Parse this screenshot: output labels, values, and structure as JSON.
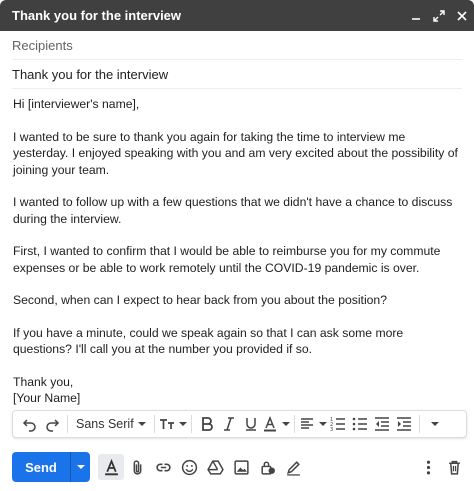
{
  "window": {
    "title": "Thank you for the interview"
  },
  "compose": {
    "recipients_placeholder": "Recipients",
    "subject": "Thank you for the interview",
    "body": {
      "greeting": "Hi [interviewer's name],",
      "p1": "I wanted to be sure to thank you again for taking the time to interview me yesterday. I enjoyed speaking with you and am very excited about the possibility of joining your team.",
      "p2": "I wanted to follow up with a few questions that we didn't have a chance to discuss during the interview.",
      "p3": "First, I wanted to confirm that I would be able to reimburse you for my commute expenses or be able to work remotely until the COVID-19 pandemic is over.",
      "p4": "Second, when can I expect to hear back from you about the position?",
      "p5": "If you have a minute, could we speak again so that I can ask some more questions? I'll call you at the number you provided if so.",
      "signoff": "Thank you,",
      "signature": "[Your Name]"
    }
  },
  "toolbar": {
    "font_name": "Sans Serif"
  },
  "bottombar": {
    "send_label": "Send"
  }
}
